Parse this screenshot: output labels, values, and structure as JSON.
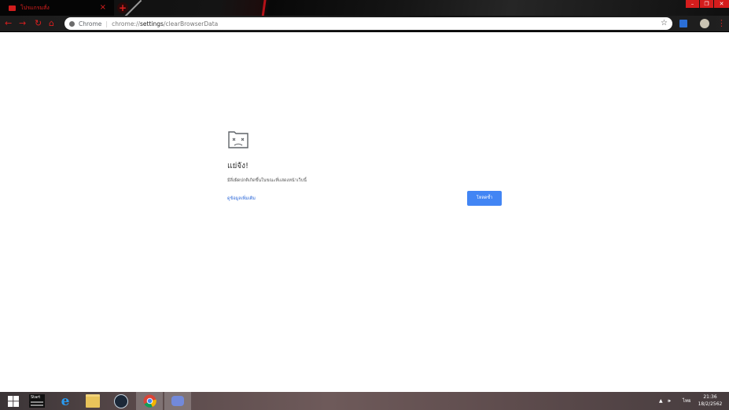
{
  "browser": {
    "tab_title": "โปรแกรมสั่ง",
    "tab_close": "×",
    "new_tab": "+",
    "window_controls": {
      "minimize": "–",
      "restore": "❐",
      "close": "✕"
    },
    "nav": {
      "back": "←",
      "forward": "→",
      "reload": "↻",
      "home": "⌂"
    },
    "omnibox": {
      "scheme_label": "Chrome",
      "separator": "|",
      "url_prefix": "chrome://",
      "url_host": "settings",
      "url_path": "/clearBrowserData",
      "star": "☆"
    },
    "menu": "⋮"
  },
  "error_page": {
    "icon": "sad-tab-icon",
    "title": "แย่จัง!",
    "description": "มีสิ่งผิดปกติเกิดขึ้นในขณะที่แสดงหน้าเว็บนี้",
    "learn_more_link": "ดูข้อมูลเพิ่มเติม",
    "reload_button": "โหลดซ้ำ"
  },
  "taskbar": {
    "start_icon": "windows-start-icon",
    "pinned": [
      {
        "name": "start-menu-app-icon",
        "label": "Start"
      },
      {
        "name": "internet-explorer-icon",
        "label": "e"
      },
      {
        "name": "file-explorer-icon",
        "label": ""
      },
      {
        "name": "steam-icon",
        "label": ""
      },
      {
        "name": "chrome-icon",
        "label": ""
      },
      {
        "name": "discord-icon",
        "label": ""
      }
    ],
    "tray": {
      "arrow": "▲",
      "volume": "🕪",
      "language": "ไทย",
      "time": "21:36",
      "date": "18/2/2562"
    }
  },
  "colors": {
    "accent_red": "#d81f1f",
    "reload_blue": "#4285f4",
    "link_blue": "#2a66d8"
  }
}
